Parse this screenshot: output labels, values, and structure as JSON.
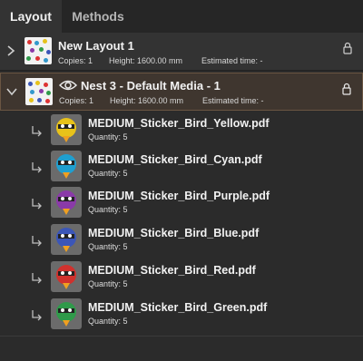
{
  "tabs": [
    {
      "label": "Layout",
      "active": true
    },
    {
      "label": "Methods",
      "active": false
    }
  ],
  "layouts": [
    {
      "title": "New Layout 1",
      "copies": "Copies: 1",
      "height": "Height: 1600.00 mm",
      "estimated": "Estimated time: -",
      "expanded": false
    },
    {
      "title": "Nest 3 - Default Media - 1",
      "copies": "Copies: 1",
      "height": "Height: 1600.00 mm",
      "estimated": "Estimated time: -",
      "expanded": true
    }
  ],
  "items": [
    {
      "name": "MEDIUM_Sticker_Bird_Yellow.pdf",
      "quantity": "Quantity: 5",
      "color": "#e8c21a"
    },
    {
      "name": "MEDIUM_Sticker_Bird_Cyan.pdf",
      "quantity": "Quantity: 5",
      "color": "#1f9fd0"
    },
    {
      "name": "MEDIUM_Sticker_Bird_Purple.pdf",
      "quantity": "Quantity: 5",
      "color": "#8a3aa8"
    },
    {
      "name": "MEDIUM_Sticker_Bird_Blue.pdf",
      "quantity": "Quantity: 5",
      "color": "#3b56b8"
    },
    {
      "name": "MEDIUM_Sticker_Bird_Red.pdf",
      "quantity": "Quantity: 5",
      "color": "#d0312d"
    },
    {
      "name": "MEDIUM_Sticker_Bird_Green.pdf",
      "quantity": "Quantity: 5",
      "color": "#2f9a4a"
    }
  ]
}
